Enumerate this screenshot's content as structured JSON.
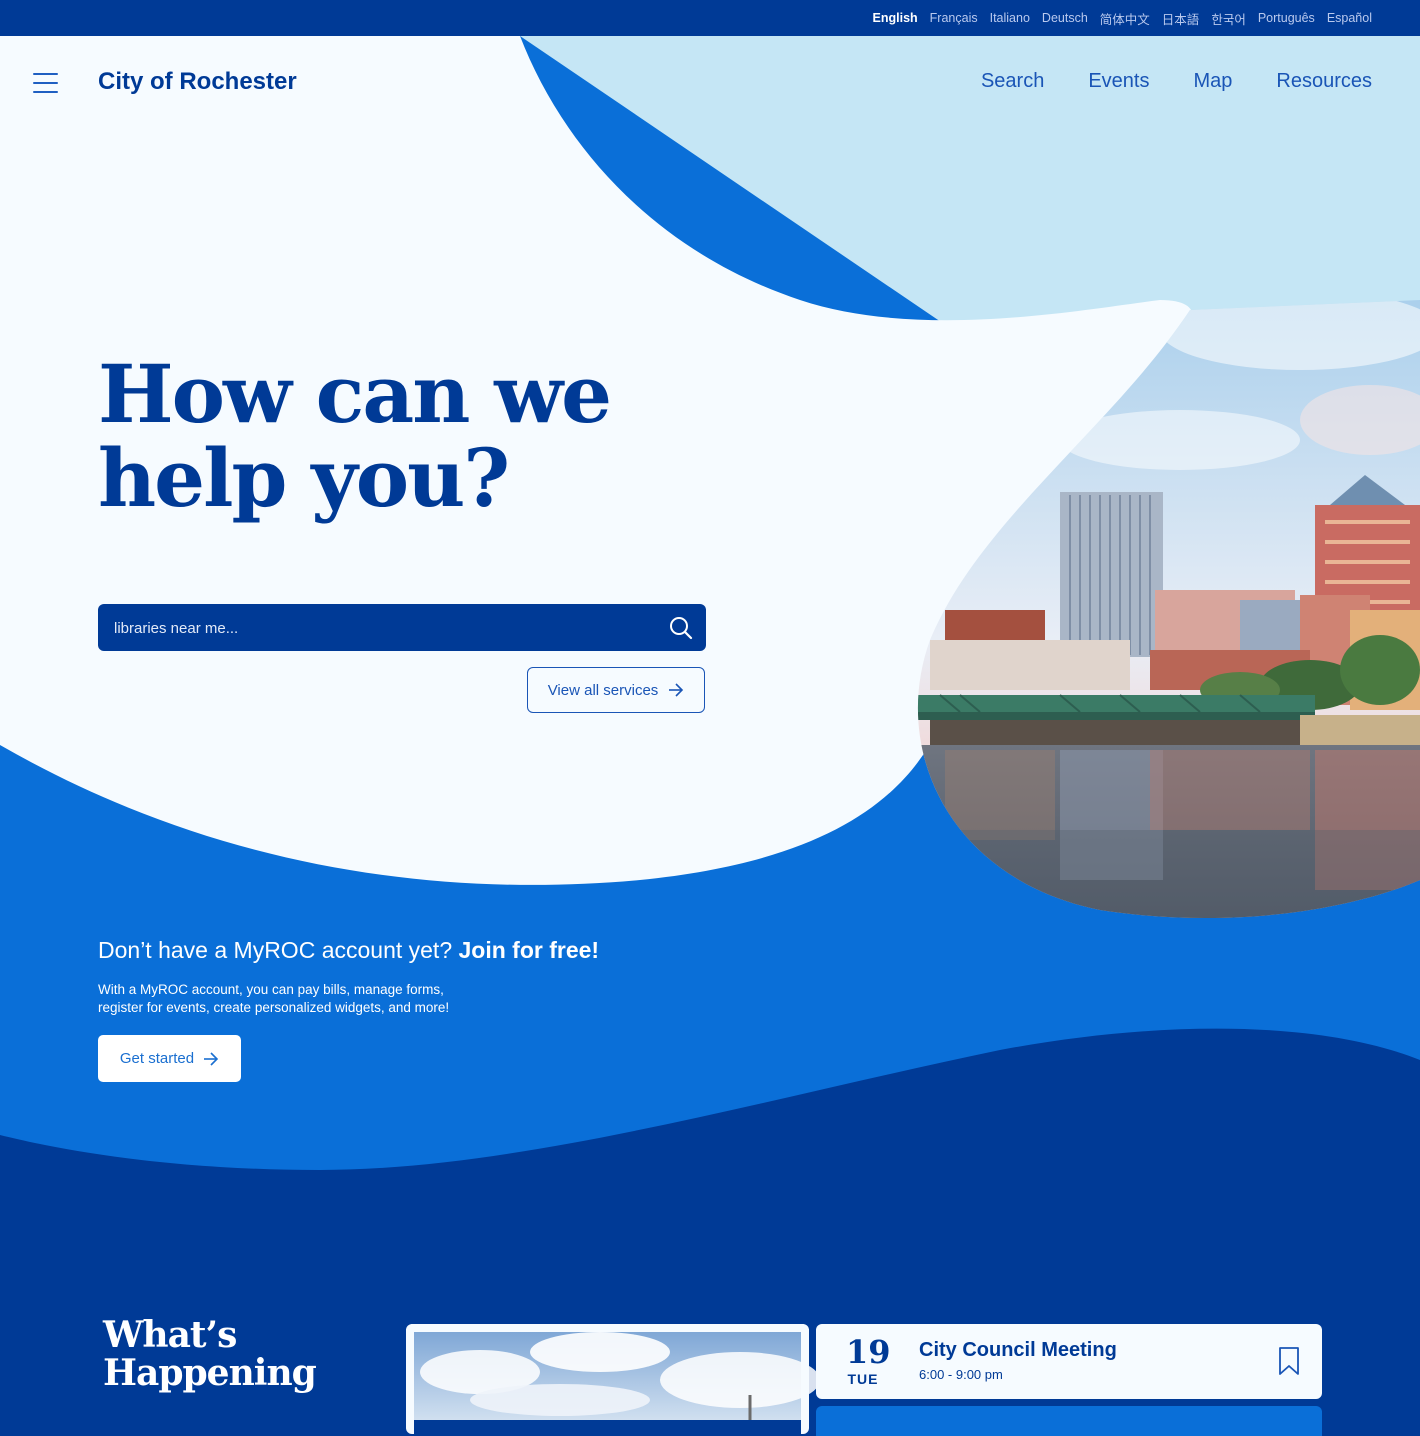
{
  "languages": {
    "items": [
      "English",
      "Français",
      "Italiano",
      "Deutsch",
      "简体中文",
      "日本語",
      "한국어",
      "Português",
      "Español"
    ],
    "active": "English"
  },
  "header": {
    "site_title": "City of Rochester",
    "nav": [
      "Search",
      "Events",
      "Map",
      "Resources"
    ]
  },
  "hero": {
    "title_line1": "How can we",
    "title_line2": "help you?",
    "search_placeholder": "libraries near me...",
    "services_button": "View all services"
  },
  "account_cta": {
    "title_prefix": "Don’t have a MyROC account yet?",
    "title_emphasis": "Join for free!",
    "description_line1": "With a MyROC account, you can pay bills, manage forms,",
    "description_line2": "register for events, create personalized widgets, and more!",
    "button": "Get started"
  },
  "whats_happening": {
    "title_line1": "What’s",
    "title_line2": "Happening",
    "events": [
      {
        "day": "19",
        "weekday": "TUE",
        "title": "City Council Meeting",
        "time": "6:00 - 9:00 pm"
      }
    ]
  },
  "colors": {
    "navy": "#003a96",
    "bright_blue": "#0a6fd8",
    "sky": "#c5e6f5",
    "page_white": "#f6fbff"
  },
  "icons": [
    "menu-icon",
    "search-icon",
    "arrow-right-icon",
    "bookmark-icon"
  ]
}
